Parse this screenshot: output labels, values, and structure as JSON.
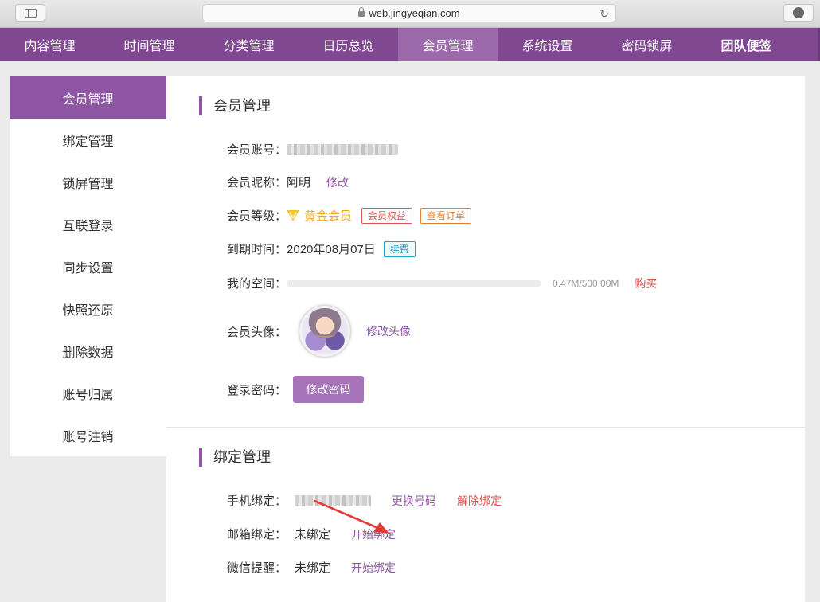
{
  "browser": {
    "url": "web.jingyeqian.com"
  },
  "topnav": {
    "items": [
      {
        "label": "内容管理"
      },
      {
        "label": "时间管理"
      },
      {
        "label": "分类管理"
      },
      {
        "label": "日历总览"
      },
      {
        "label": "会员管理",
        "active": true
      },
      {
        "label": "系统设置"
      },
      {
        "label": "密码锁屏"
      },
      {
        "label": "团队便签"
      }
    ]
  },
  "sidebar": {
    "items": [
      {
        "label": "会员管理",
        "active": true
      },
      {
        "label": "绑定管理"
      },
      {
        "label": "锁屏管理"
      },
      {
        "label": "互联登录"
      },
      {
        "label": "同步设置"
      },
      {
        "label": "快照还原"
      },
      {
        "label": "删除数据"
      },
      {
        "label": "账号归属"
      },
      {
        "label": "账号注销"
      }
    ]
  },
  "member": {
    "title": "会员管理",
    "account_label": "会员账号：",
    "nickname_label": "会员昵称：",
    "nickname": "阿明",
    "nickname_edit": "修改",
    "level_label": "会员等级：",
    "level": "黄金会员",
    "benefits_badge": "会员权益",
    "orders_badge": "查看订单",
    "expire_label": "到期时间：",
    "expire_date": "2020年08月07日",
    "renew_badge": "续费",
    "space_label": "我的空间：",
    "space_used_fraction": 0.00094,
    "space_text": "0.47M/500.00M",
    "buy_link": "购买",
    "avatar_label": "会员头像：",
    "avatar_edit": "修改头像",
    "password_label": "登录密码：",
    "password_button": "修改密码"
  },
  "binding": {
    "title": "绑定管理",
    "phone_label": "手机绑定：",
    "phone_change": "更换号码",
    "phone_unbind": "解除绑定",
    "email_label": "邮箱绑定：",
    "email_status": "未绑定",
    "email_action": "开始绑定",
    "wechat_label": "微信提醒：",
    "wechat_status": "未绑定",
    "wechat_action": "开始绑定"
  },
  "colors": {
    "brand_purple": "#7f4891",
    "active_tab": "#9c6aaa",
    "gold": "#f5a623",
    "red": "#e0544d",
    "arrow": "#e53935"
  }
}
